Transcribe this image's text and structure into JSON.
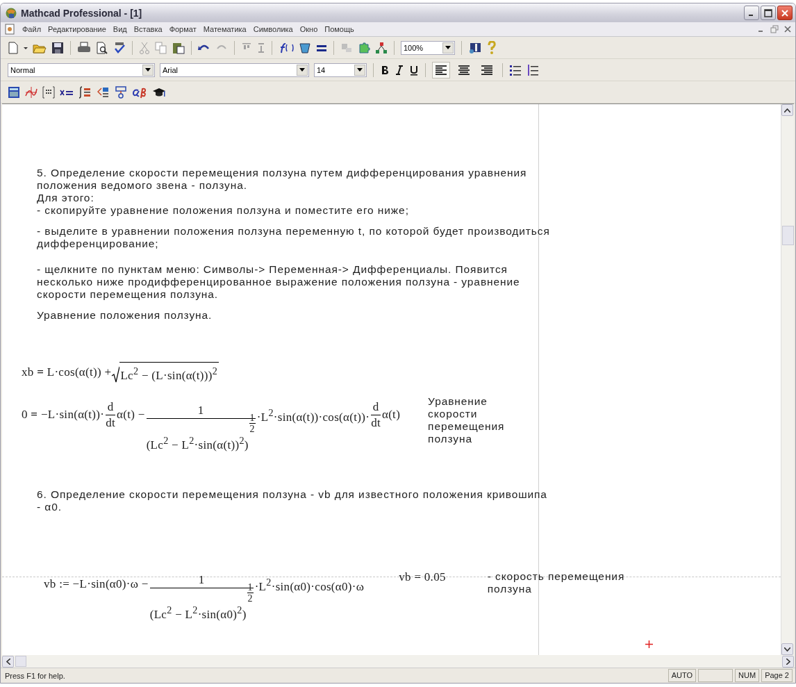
{
  "window": {
    "title": "Mathcad Professional - [1]"
  },
  "menu": [
    "Файл",
    "Редактирование",
    "Вид",
    "Вставка",
    "Формат",
    "Математика",
    "Символика",
    "Окно",
    "Помощь"
  ],
  "toolbar": {
    "zoom": "100%"
  },
  "format_bar": {
    "style": "Normal",
    "font": "Arial",
    "size": "14",
    "alignment": [
      {
        "selected": true
      },
      {
        "selected": false
      },
      {
        "selected": false
      }
    ]
  },
  "document": {
    "blocks": [
      {
        "kind": "text",
        "text": "5. Определение скорости перемещения ползуна путем дифференцирования уравнения положения ведомого звена - ползуна."
      },
      {
        "kind": "text",
        "text": "Для этого:"
      },
      {
        "kind": "text",
        "text": "- скопируйте уравнение положения ползуна и поместите его ниже;"
      },
      {
        "kind": "text",
        "text": "- выделите в уравнении положения ползуна переменную t, по которой будет производиться дифференцирование;"
      },
      {
        "kind": "text",
        "text": "- щелкните по пунктам меню: Символы-> Переменная-> Дифференциалы. Появится несколько ниже продифференцированное выражение положения ползуна - уравнение скорости перемещения ползуна."
      },
      {
        "kind": "text",
        "text": "Уравнение положения ползуна."
      },
      {
        "kind": "formula",
        "parts": [
          {
            "kind": "text",
            "text": "xb **=** L·cos(α(t)) + "
          },
          {
            "kind": "sqrt",
            "text": "Lc$^{2}$ − (L·sin(α(t)))$^{2}$"
          }
        ]
      },
      {
        "kind": "formula",
        "note": "Уравнение скорости перемещения ползуна",
        "parts": [
          {
            "kind": "text",
            "text": "0 **=** −L·sin(α(t))·"
          },
          {
            "kind": "frac",
            "num": "d",
            "den": "dt"
          },
          {
            "kind": "text",
            "text": "α(t) − "
          },
          {
            "kind": "frac",
            "num": "1",
            "den": "(Lc$^{2}$ − L$^{2}$·sin(α(t))$^{2}$)",
            "exp": {
              "num": "1",
              "den": "2"
            }
          },
          {
            "kind": "text",
            "text": "·L$^{2}$·sin(α(t))·cos(α(t))·"
          },
          {
            "kind": "frac",
            "num": "d",
            "den": "dt"
          },
          {
            "kind": "text",
            "text": "α(t)"
          }
        ]
      },
      {
        "kind": "text",
        "text": "6. Определение скорости перемещения ползуна - vb для известного положения кривошипа - α0."
      },
      {
        "kind": "formula",
        "result": "vb = 0.05",
        "note": "- скорость перемещения ползуна",
        "parts": [
          {
            "kind": "text",
            "text": "vb := −L·sin(α0)·ω − "
          },
          {
            "kind": "frac",
            "num": "1",
            "den": "(Lc$^{2}$ − L$^{2}$·sin(α0)$^{2}$)",
            "exp": {
              "num": "1",
              "den": "2"
            }
          },
          {
            "kind": "text",
            "text": "·L$^{2}$·sin(α0)·cos(α0)·ω"
          }
        ]
      }
    ]
  },
  "status_bar": {
    "help": "Press F1 for help.",
    "mode": "AUTO",
    "num": "NUM",
    "page": "Page 2"
  }
}
